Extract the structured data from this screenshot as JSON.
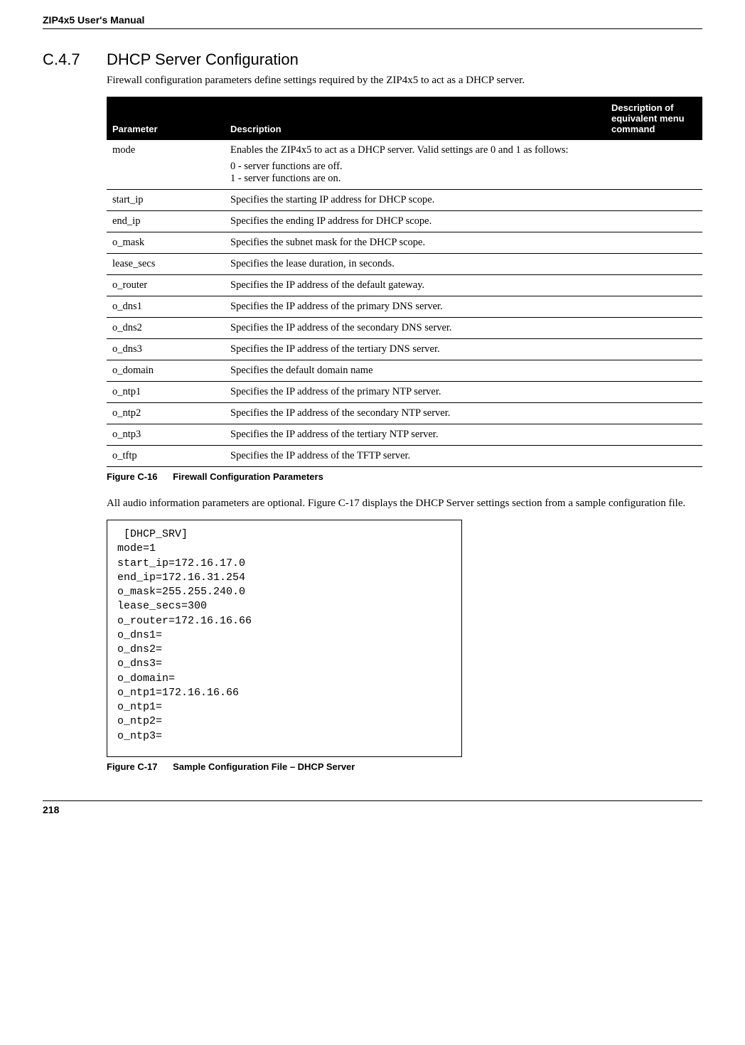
{
  "header": {
    "manual_title": "ZIP4x5 User's Manual"
  },
  "section": {
    "number": "C.4.7",
    "title": "DHCP Server Configuration",
    "intro": "Firewall configuration parameters define settings required by the ZIP4x5 to act as a DHCP server."
  },
  "table": {
    "headers": {
      "parameter": "Parameter",
      "description": "Description",
      "equivalent": "Description of equivalent menu command"
    },
    "rows": [
      {
        "param": "mode",
        "desc_line1": "Enables the ZIP4x5 to act as a DHCP server. Valid settings are 0 and 1 as follows:",
        "desc_line2": "0 - server functions are off.",
        "desc_line3": "1 - server functions are on.",
        "equiv": ""
      },
      {
        "param": "start_ip",
        "desc": "Specifies the starting IP address for DHCP scope.",
        "equiv": ""
      },
      {
        "param": "end_ip",
        "desc": "Specifies the ending IP address for DHCP scope.",
        "equiv": ""
      },
      {
        "param": "o_mask",
        "desc": "Specifies the subnet mask for the DHCP scope.",
        "equiv": ""
      },
      {
        "param": "lease_secs",
        "desc": "Specifies the lease duration, in seconds.",
        "equiv": ""
      },
      {
        "param": "o_router",
        "desc": "Specifies the IP address of the default gateway.",
        "equiv": ""
      },
      {
        "param": "o_dns1",
        "desc": "Specifies the IP address of the primary DNS server.",
        "equiv": ""
      },
      {
        "param": "o_dns2",
        "desc": "Specifies the IP address of the secondary DNS server.",
        "equiv": ""
      },
      {
        "param": "o_dns3",
        "desc": "Specifies the IP address of the tertiary DNS server.",
        "equiv": ""
      },
      {
        "param": "o_domain",
        "desc": "Specifies the default domain name",
        "equiv": ""
      },
      {
        "param": "o_ntp1",
        "desc": "Specifies the IP address of the primary NTP server.",
        "equiv": ""
      },
      {
        "param": "o_ntp2",
        "desc": "Specifies the IP address of the secondary NTP server.",
        "equiv": ""
      },
      {
        "param": "o_ntp3",
        "desc": "Specifies the IP address of the tertiary NTP server.",
        "equiv": ""
      },
      {
        "param": "o_tftp",
        "desc": "Specifies the IP address of the TFTP server.",
        "equiv": ""
      }
    ]
  },
  "figure16": {
    "label": "Figure C-16",
    "caption": "Firewall Configuration Parameters"
  },
  "para_after": "All audio information parameters are optional. Figure C-17 displays the DHCP Server settings section from a sample configuration file.",
  "code_block": " [DHCP_SRV]\nmode=1\nstart_ip=172.16.17.0\nend_ip=172.16.31.254\no_mask=255.255.240.0\nlease_secs=300\no_router=172.16.16.66\no_dns1=\no_dns2=\no_dns3=\no_domain=\no_ntp1=172.16.16.66\no_ntp1=\no_ntp2=\no_ntp3=",
  "figure17": {
    "label": "Figure C-17",
    "caption": "Sample Configuration File – DHCP Server"
  },
  "footer": {
    "page_number": "218"
  }
}
